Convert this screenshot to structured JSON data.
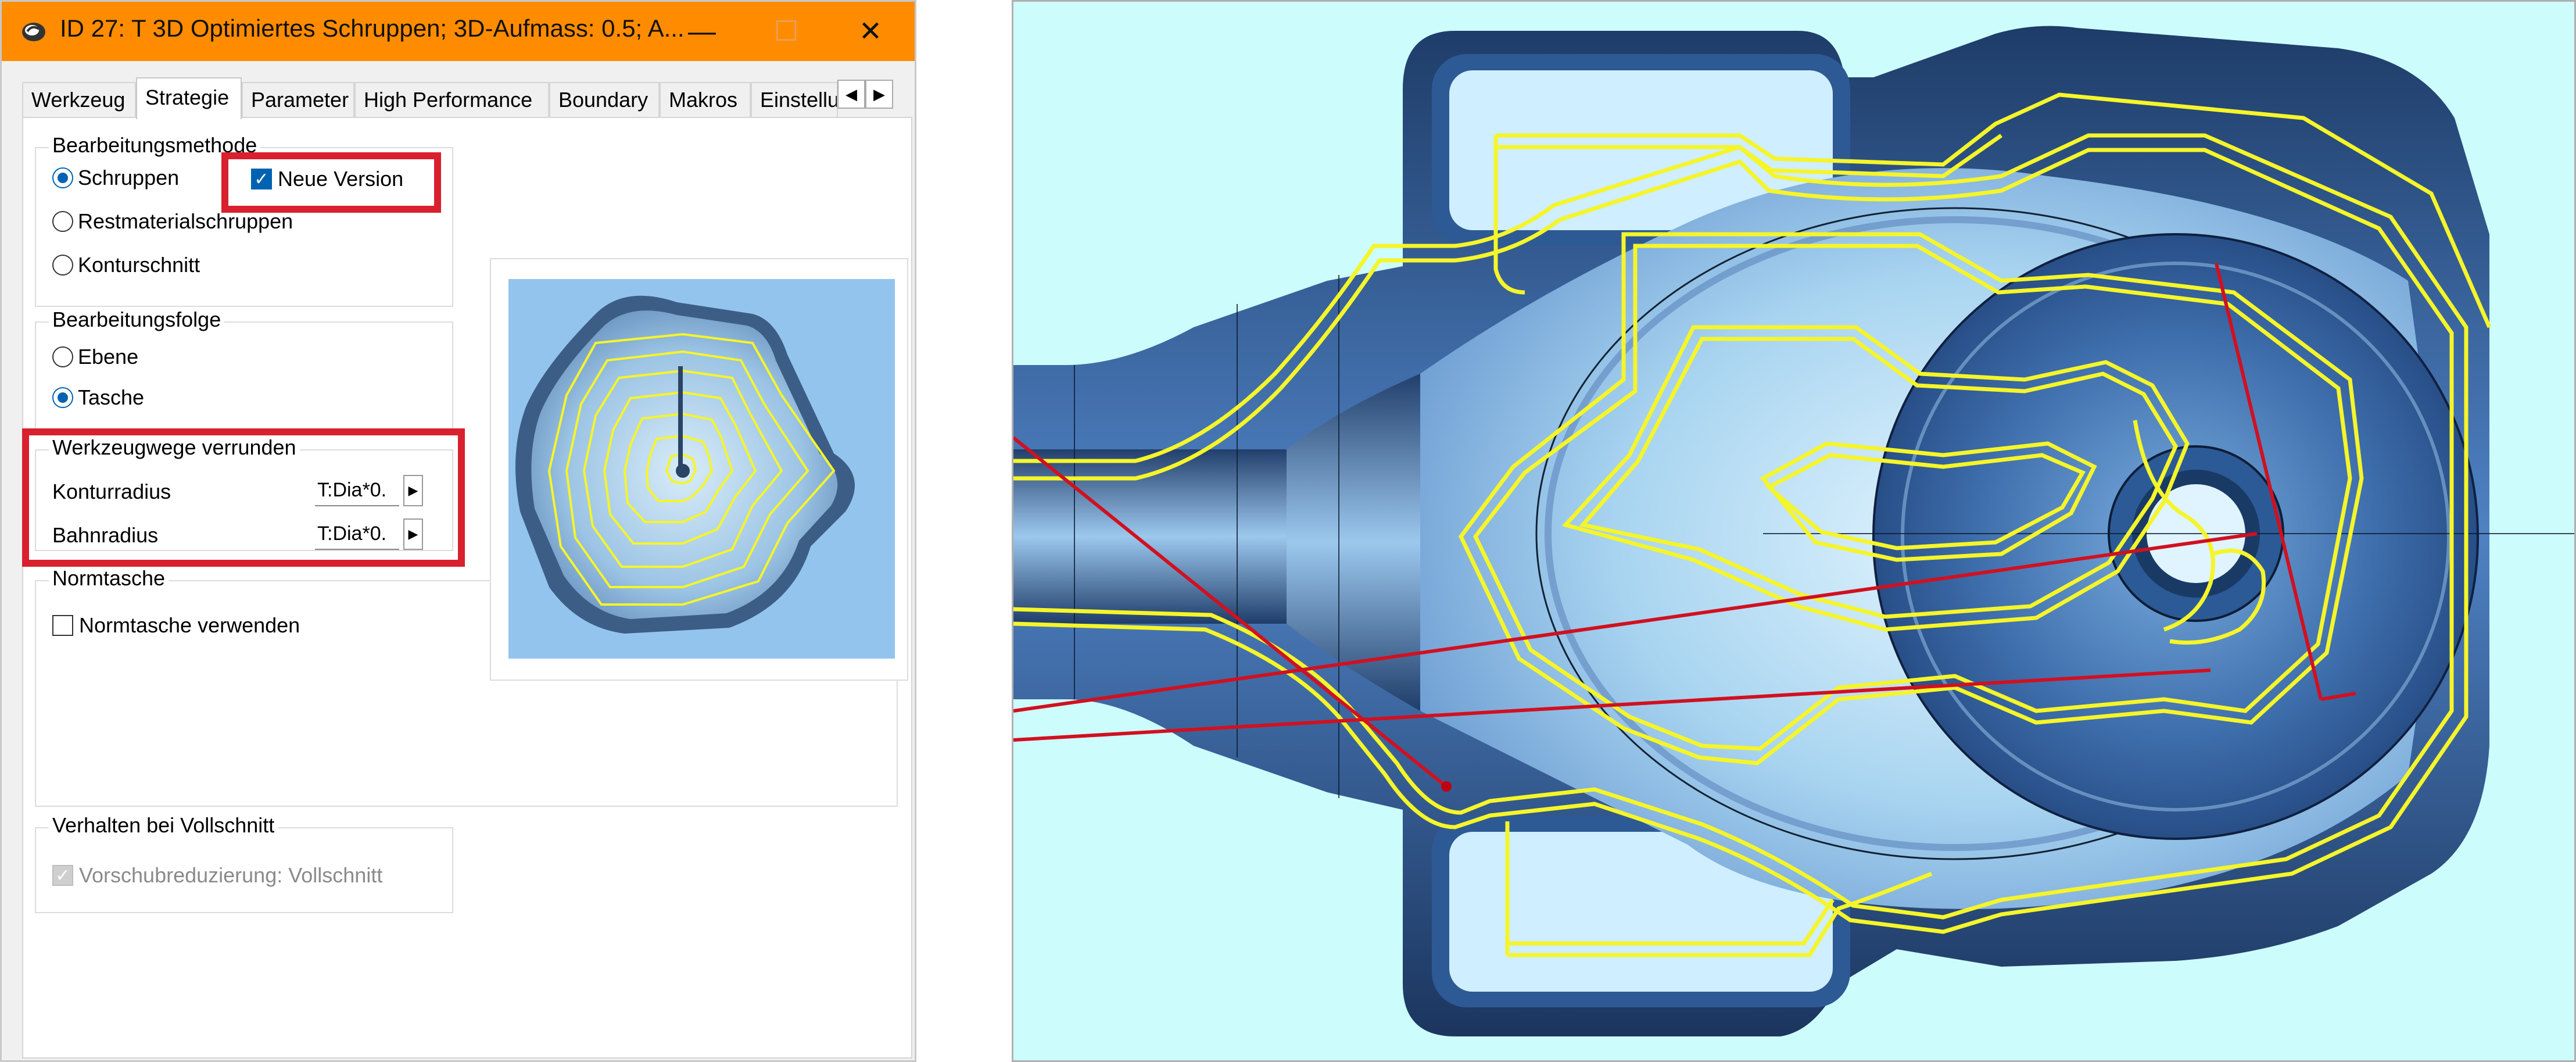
{
  "window": {
    "title": "ID 27: T 3D Optimiertes Schruppen; 3D-Aufmass: 0.5; A...",
    "minimize": "—",
    "maximize": "☐",
    "close": "✕"
  },
  "tabs": [
    {
      "label": "Werkzeug"
    },
    {
      "label": "Strategie",
      "active": true
    },
    {
      "label": "Parameter"
    },
    {
      "label": "High Performance"
    },
    {
      "label": "Boundary"
    },
    {
      "label": "Makros"
    },
    {
      "label": "Einstellur"
    }
  ],
  "tab_scroll": {
    "left": "◀",
    "right": "▶"
  },
  "bearbeitungsmethode": {
    "caption": "Bearbeitungsmethode",
    "options": [
      "Schruppen",
      "Restmaterialschruppen",
      "Konturschnitt"
    ],
    "selected": "Schruppen",
    "neue_version": {
      "label": "Neue Version",
      "checked": true
    }
  },
  "bearbeitungsfolge": {
    "caption": "Bearbeitungsfolge",
    "options": [
      "Ebene",
      "Tasche"
    ],
    "selected": "Tasche"
  },
  "werkzeugwege": {
    "caption": "Werkzeugwege verrunden",
    "konturradius": {
      "label": "Konturradius",
      "value": "T:Dia*0."
    },
    "bahnradius": {
      "label": "Bahnradius",
      "value": "T:Dia*0."
    }
  },
  "normtasche": {
    "caption": "Normtasche",
    "checkbox": {
      "label": "Normtasche verwenden",
      "checked": false
    }
  },
  "vollschnitt": {
    "caption": "Verhalten bei Vollschnitt",
    "checkbox": {
      "label": "Vorschubreduzierung: Vollschnitt",
      "checked": true,
      "disabled": true
    }
  },
  "colors": {
    "titlebar": "#ff8c00",
    "accent": "#0063b1",
    "highlight": "#d9202e",
    "toolpath": "#f5f52a",
    "viewport_bg": "#cdfcfc"
  }
}
